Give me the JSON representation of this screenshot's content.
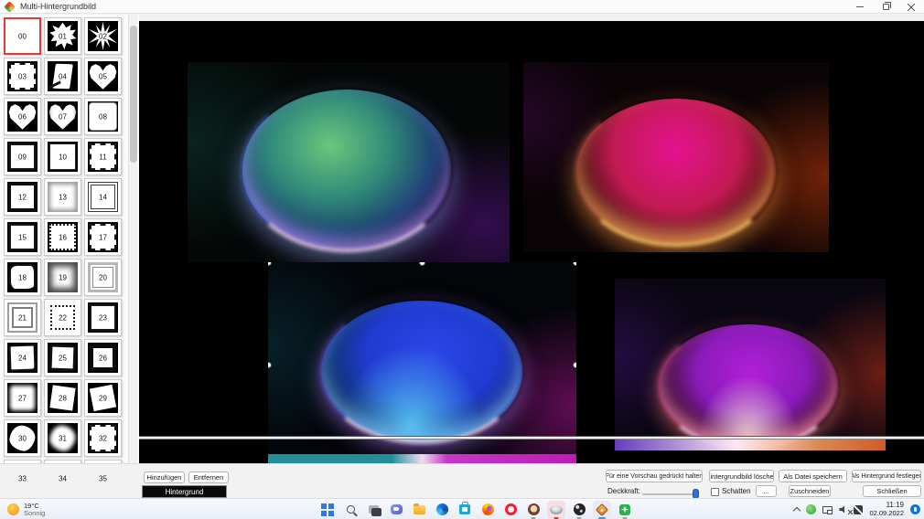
{
  "window": {
    "title": "Multi-Hintergrundbild"
  },
  "colors": {
    "accent_blue": "#2f6fd6",
    "selected_red": "#e23b3b",
    "canvas_bg": "#000000",
    "taskbar_bg": "#eef2f9",
    "background_button_bg": "#0a0a0a"
  },
  "sidebar": {
    "thumbnails": [
      {
        "num": "00",
        "cls": "m-blank sel"
      },
      {
        "num": "01",
        "cls": "m-leaf"
      },
      {
        "num": "02",
        "cls": "m-flake"
      },
      {
        "num": "03",
        "cls": "m-grunge"
      },
      {
        "num": "04",
        "cls": "m-scroll"
      },
      {
        "num": "05",
        "cls": "m-heart"
      },
      {
        "num": "06",
        "cls": "m-heart"
      },
      {
        "num": "07",
        "cls": "m-heartsoft"
      },
      {
        "num": "08",
        "cls": "m-round"
      },
      {
        "num": "09",
        "cls": "m-frame-rough"
      },
      {
        "num": "10",
        "cls": "m-frame-thin"
      },
      {
        "num": "11",
        "cls": "m-frame-rough2"
      },
      {
        "num": "12",
        "cls": "m-frame-solid"
      },
      {
        "num": "13",
        "cls": "m-frame-soft"
      },
      {
        "num": "14",
        "cls": "m-frame-hatch"
      },
      {
        "num": "15",
        "cls": "m-frame-rough"
      },
      {
        "num": "16",
        "cls": "m-frame-dotted"
      },
      {
        "num": "17",
        "cls": "m-frame-rough2"
      },
      {
        "num": "18",
        "cls": "m-blob"
      },
      {
        "num": "19",
        "cls": "m-vignette"
      },
      {
        "num": "20",
        "cls": "m-frame-gray"
      },
      {
        "num": "21",
        "cls": "m-frame-double"
      },
      {
        "num": "22",
        "cls": "m-dotted2"
      },
      {
        "num": "23",
        "cls": "m-frame-rough"
      },
      {
        "num": "24",
        "cls": "m-blob2"
      },
      {
        "num": "25",
        "cls": "m-blob3"
      },
      {
        "num": "26",
        "cls": "m-frame-thick"
      },
      {
        "num": "27",
        "cls": "m-fuzzy"
      },
      {
        "num": "28",
        "cls": "m-rot1"
      },
      {
        "num": "29",
        "cls": "m-rot2"
      },
      {
        "num": "30",
        "cls": "m-pin"
      },
      {
        "num": "31",
        "cls": "m-pinsoft"
      },
      {
        "num": "32",
        "cls": "m-frame-rough2"
      },
      {
        "num": "33",
        "cls": "m-speckle"
      },
      {
        "num": "34",
        "cls": "m-grunge2"
      },
      {
        "num": "35",
        "cls": "m-grunge3"
      }
    ]
  },
  "previews": [
    {
      "name": "wallpaper-green-orb",
      "cls": "img1"
    },
    {
      "name": "wallpaper-magenta-orb",
      "cls": "img2"
    },
    {
      "name": "wallpaper-blue-orb-selected",
      "cls": "img3 sel"
    },
    {
      "name": "wallpaper-violet-orb",
      "cls": "img4"
    }
  ],
  "toolbar": {
    "add": "Hinzufügen",
    "remove": "Entfernen",
    "background": "Hintergrund",
    "hold_preview": "Für eine Vorschau gedrückt halten",
    "delete_wallpaper": "Hintergrundbild löschen",
    "save_as_file": "Als Datei speichern",
    "set_as_wallpaper": "Als Hintergrund festlegen",
    "opacity_label": "Deckkraft:",
    "shadow_label": "Schatten",
    "more": "...",
    "crop": "Zuschneiden",
    "close": "Schließen"
  },
  "taskbar": {
    "weather": {
      "temp": "19°C",
      "condition": "Sonnig"
    },
    "apps": [
      {
        "name": "start-icon",
        "cls": "ic-win"
      },
      {
        "name": "search-icon",
        "cls": "ic-search"
      },
      {
        "name": "task-view-icon",
        "cls": "ic-taskview"
      },
      {
        "name": "chat-icon",
        "cls": "ic-chat"
      },
      {
        "name": "file-explorer-icon",
        "cls": "ic-folder"
      },
      {
        "name": "edge-icon",
        "cls": "ic-edge"
      },
      {
        "name": "store-icon",
        "cls": "ic-store"
      },
      {
        "name": "firefox-icon",
        "cls": "ic-firefox"
      },
      {
        "name": "opera-icon",
        "cls": "ic-opera"
      },
      {
        "name": "thunderbird-icon",
        "cls": "ic-bird run"
      },
      {
        "name": "photo-tool-icon",
        "cls": "ic-dove act-pink red-dot"
      },
      {
        "name": "camera-tool-icon",
        "cls": "ic-lens run"
      },
      {
        "name": "multi-hintergrundbild-icon",
        "cls": "ic-compass act-gray blue-dot"
      },
      {
        "name": "snipping-tool-icon",
        "cls": "ic-burst run"
      }
    ],
    "tray": [
      {
        "name": "hidden-icons-chevron-icon",
        "cls": "tr-chev"
      },
      {
        "name": "antivirus-icon",
        "cls": "tr-green"
      },
      {
        "name": "display-icon",
        "cls": "tr-display"
      },
      {
        "name": "volume-muted-icon",
        "cls": "tr-mute"
      },
      {
        "name": "pen-icon",
        "cls": "tr-pen"
      }
    ],
    "clock": {
      "time": "11:19",
      "date": "02.09.2022"
    }
  }
}
